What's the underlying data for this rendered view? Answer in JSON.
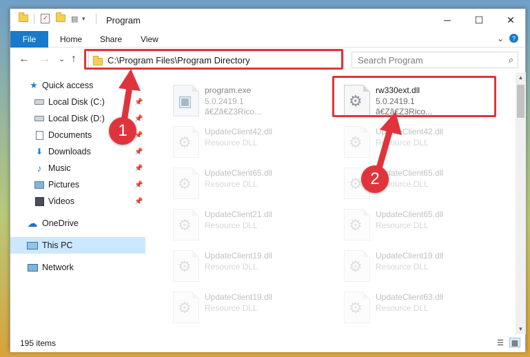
{
  "window": {
    "title": "Program",
    "controls": {
      "minimize": "─",
      "maximize": "☐",
      "close": "✕"
    }
  },
  "ribbon": {
    "tabs": [
      "File",
      "Home",
      "Share",
      "View"
    ],
    "expand_glyph": "⌄",
    "help_glyph": "?"
  },
  "navigation": {
    "back": "←",
    "forward": "→",
    "recent": "⌄",
    "up": "↑",
    "address": "C:\\Program Files\\Program Directory",
    "address_dropdown": "⌄",
    "refresh": "↻",
    "search_placeholder": "Search Program",
    "search_glyph": "⌕"
  },
  "sidebar": {
    "pin_glyph": "📌",
    "items": [
      {
        "label": "Quick access",
        "icon": "star-icon",
        "glyph": "★",
        "pinned": false
      },
      {
        "label": "Local Disk (C:)",
        "icon": "drive-icon",
        "pinned": true
      },
      {
        "label": "Local Disk (D:)",
        "icon": "drive-icon",
        "pinned": true
      },
      {
        "label": "Documents",
        "icon": "documents-icon",
        "pinned": true
      },
      {
        "label": "Downloads",
        "icon": "download-icon",
        "glyph": "⬇",
        "pinned": true
      },
      {
        "label": "Music",
        "icon": "music-icon",
        "glyph": "♪",
        "pinned": true
      },
      {
        "label": "Pictures",
        "icon": "pictures-icon",
        "pinned": true
      },
      {
        "label": "Videos",
        "icon": "videos-icon",
        "pinned": true
      },
      {
        "label": "OneDrive",
        "icon": "cloud-icon",
        "glyph": "☁",
        "pinned": false
      },
      {
        "label": "This PC",
        "icon": "computer-icon",
        "pinned": false,
        "selected": true
      },
      {
        "label": "Network",
        "icon": "network-icon",
        "pinned": false
      }
    ]
  },
  "files": [
    {
      "name": "program.exe",
      "line2": "5.0.2419.1",
      "line3": "ã€Zã€Z3Rico...",
      "icon": "exe-file-icon"
    },
    {
      "name": "rw330ext.dll",
      "line2": "5.0.2419.1",
      "line3": "ã€Zã€Z3Rico...",
      "icon": "dll-file-icon",
      "highlighted": true
    },
    {
      "name": "UpdateClient42.dll",
      "line2": "Resource DLL",
      "icon": "dll-file-icon"
    },
    {
      "name": "UpdateClient42.dll",
      "line2": "Resource DLL",
      "icon": "dll-file-icon"
    },
    {
      "name": "UpdateClient65.dll",
      "line2": "Resource DLL",
      "icon": "dll-file-icon"
    },
    {
      "name": "UpdateClient65.dll",
      "line2": "Resource DLL",
      "icon": "dll-file-icon"
    },
    {
      "name": "UpdateClient21.dll",
      "line2": "Resource DLL",
      "icon": "dll-file-icon"
    },
    {
      "name": "UpdateClient65.dll",
      "line2": "Resource DLL",
      "icon": "dll-file-icon"
    },
    {
      "name": "UpdateClient19.dll",
      "line2": "Resource DLL",
      "icon": "dll-file-icon"
    },
    {
      "name": "UpdateClient19.dll",
      "line2": "Resource DLL",
      "icon": "dll-file-icon"
    },
    {
      "name": "UpdateClient19.dll",
      "line2": "Resource DLL",
      "icon": "dll-file-icon"
    },
    {
      "name": "UpdateClient63.dll",
      "line2": "Resource DLL",
      "icon": "dll-file-icon"
    }
  ],
  "status": {
    "item_count": "195 items",
    "details_view_glyph": "☰",
    "tiles_view_glyph": "▦"
  },
  "callouts": [
    "1",
    "2"
  ],
  "colors": {
    "accent": "#1979ca",
    "highlight_red": "#e0343c",
    "selected_nav": "#cce8ff"
  }
}
